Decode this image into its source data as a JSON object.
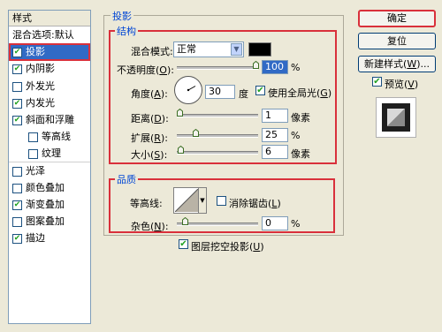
{
  "left_panel": {
    "header": "样式",
    "items": [
      {
        "label": "混合选项:默认",
        "checkbox": false,
        "checked": false,
        "indent": 0,
        "selected": false
      },
      {
        "label": "投影",
        "checkbox": true,
        "checked": true,
        "indent": 0,
        "selected": true
      },
      {
        "label": "内阴影",
        "checkbox": true,
        "checked": true,
        "indent": 0,
        "selected": false
      },
      {
        "label": "外发光",
        "checkbox": true,
        "checked": false,
        "indent": 0,
        "selected": false
      },
      {
        "label": "内发光",
        "checkbox": true,
        "checked": true,
        "indent": 0,
        "selected": false
      },
      {
        "label": "斜面和浮雕",
        "checkbox": true,
        "checked": true,
        "indent": 0,
        "selected": false
      },
      {
        "label": "等高线",
        "checkbox": true,
        "checked": false,
        "indent": 1,
        "selected": false
      },
      {
        "label": "纹理",
        "checkbox": true,
        "checked": false,
        "indent": 1,
        "selected": false
      },
      {
        "label": "光泽",
        "checkbox": true,
        "checked": false,
        "indent": 0,
        "selected": false
      },
      {
        "label": "颜色叠加",
        "checkbox": true,
        "checked": false,
        "indent": 0,
        "selected": false
      },
      {
        "label": "渐变叠加",
        "checkbox": true,
        "checked": true,
        "indent": 0,
        "selected": false
      },
      {
        "label": "图案叠加",
        "checkbox": true,
        "checked": false,
        "indent": 0,
        "selected": false
      },
      {
        "label": "描边",
        "checkbox": true,
        "checked": true,
        "indent": 0,
        "selected": false
      }
    ]
  },
  "drop_shadow": {
    "title": "投影",
    "structure_title": "结构",
    "blend_mode_label": "混合模式:",
    "blend_mode_value": "正常",
    "shadow_color": "#000000",
    "opacity_label": "不透明度(O):",
    "opacity_value": "100",
    "opacity_unit": "%",
    "opacity_fraction": 1.0,
    "angle_label": "角度(A):",
    "angle_value": "30",
    "angle_unit": "度",
    "use_global_light_label": "使用全局光(G)",
    "use_global_light_checked": true,
    "distance_label": "距离(D):",
    "distance_value": "1",
    "distance_unit": "像素",
    "spread_label": "扩展(R):",
    "spread_value": "25",
    "spread_unit": "%",
    "size_label": "大小(S):",
    "size_value": "6",
    "size_unit": "像素",
    "quality_title": "品质",
    "contour_label": "等高线:",
    "anti_alias_label": "消除锯齿(L)",
    "anti_alias_checked": false,
    "noise_label": "杂色(N):",
    "noise_value": "0",
    "noise_unit": "%",
    "knockout_label": "图层挖空投影(U)",
    "knockout_checked": true
  },
  "right_panel": {
    "ok_label": "确定",
    "reset_label": "复位",
    "new_style_label": "新建样式(W)...",
    "preview_label": "预览(V)",
    "preview_checked": true
  }
}
